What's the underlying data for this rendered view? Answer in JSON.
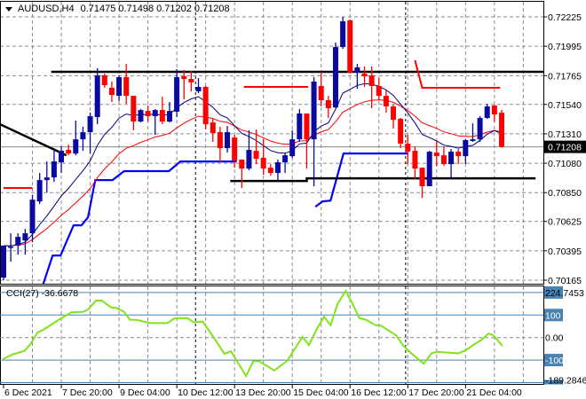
{
  "header": {
    "symbol": "AUDUSD,H4",
    "open": "0.71475",
    "high": "0.71498",
    "low": "0.71202",
    "close": "0.71208"
  },
  "indicator": {
    "name": "CCI(27)",
    "value": "-36.6678"
  },
  "colors": {
    "bull": "#0a0aa0",
    "bear": "#ff0000",
    "fast_ma": "#000080",
    "slow_ma": "#ff0000",
    "stop_line": "#0000ff",
    "cci": "#7fe51a",
    "cci_levels": "#4682b4",
    "grid": "#8a8a9a",
    "current_price_bg": "#000000"
  },
  "chart_data": [
    {
      "type": "candlestick",
      "title": "AUDUSD,H4",
      "ylim": [
        0.70165,
        0.72225
      ],
      "price_labels": [
        "0.72225",
        "0.71995",
        "0.71765",
        "0.71540",
        "0.71310",
        "0.71080",
        "0.70850",
        "0.70625",
        "0.70395",
        "0.70165"
      ],
      "current_price": "0.71208",
      "time_labels": [
        {
          "index": 0,
          "label": "6 Dec 2021"
        },
        {
          "index": 8,
          "label": "7 Dec 20:00"
        },
        {
          "index": 16,
          "label": "9 Dec 04:00"
        },
        {
          "index": 24,
          "label": "10 Dec 12:00"
        },
        {
          "index": 32,
          "label": "13 Dec 20:00"
        },
        {
          "index": 40,
          "label": "15 Dec 04:00"
        },
        {
          "index": 48,
          "label": "16 Dec 12:00"
        },
        {
          "index": 56,
          "label": "17 Dec 20:00"
        },
        {
          "index": 64,
          "label": "21 Dec 04:00"
        }
      ],
      "ohlc": [
        [
          0.70185,
          0.70435,
          0.70165,
          0.70435
        ],
        [
          0.70428,
          0.70532,
          0.7031,
          0.70428
        ],
        [
          0.70435,
          0.70532,
          0.70365,
          0.70504
        ],
        [
          0.70476,
          0.70566,
          0.70365,
          0.70532
        ],
        [
          0.70532,
          0.7083,
          0.70462,
          0.70795
        ],
        [
          0.70781,
          0.71004,
          0.70761,
          0.70948
        ],
        [
          0.70948,
          0.71094,
          0.70851,
          0.70969
        ],
        [
          0.70969,
          0.71198,
          0.70934,
          0.71094
        ],
        [
          0.71087,
          0.71212,
          0.71004,
          0.71177
        ],
        [
          0.71184,
          0.71226,
          0.71142,
          0.71156
        ],
        [
          0.71156,
          0.71413,
          0.71142,
          0.71267
        ],
        [
          0.71267,
          0.71365,
          0.71177,
          0.71323
        ],
        [
          0.71323,
          0.71476,
          0.71156,
          0.71448
        ],
        [
          0.71441,
          0.71823,
          0.71385,
          0.71767
        ],
        [
          0.71767,
          0.71781,
          0.7167,
          0.71691
        ],
        [
          0.7167,
          0.71719,
          0.71559,
          0.71614
        ],
        [
          0.71607,
          0.71767,
          0.71566,
          0.71753
        ],
        [
          0.71753,
          0.71857,
          0.71545,
          0.71607
        ],
        [
          0.71607,
          0.71607,
          0.71337,
          0.71406
        ],
        [
          0.71406,
          0.71503,
          0.71399,
          0.71496
        ],
        [
          0.71489,
          0.71531,
          0.71406,
          0.71448
        ],
        [
          0.71448,
          0.71503,
          0.71302,
          0.71496
        ],
        [
          0.71496,
          0.716,
          0.71385,
          0.71406
        ],
        [
          0.71406,
          0.71559,
          0.71399,
          0.71489
        ],
        [
          0.71483,
          0.71816,
          0.71441,
          0.71753
        ],
        [
          0.7176,
          0.71809,
          0.7158,
          0.71739
        ],
        [
          0.71739,
          0.71802,
          0.71642,
          0.71712
        ],
        [
          0.71642,
          0.71746,
          0.71628,
          0.71677
        ],
        [
          0.71677,
          0.71684,
          0.71344,
          0.71385
        ],
        [
          0.71399,
          0.71427,
          0.71247,
          0.71316
        ],
        [
          0.71323,
          0.71365,
          0.71087,
          0.71198
        ],
        [
          0.71198,
          0.71372,
          0.71163,
          0.71323
        ],
        [
          0.71281,
          0.71302,
          0.71045,
          0.71101
        ],
        [
          0.71108,
          0.71108,
          0.70886,
          0.71038
        ],
        [
          0.71038,
          0.71337,
          0.71024,
          0.71184
        ],
        [
          0.71177,
          0.71344,
          0.71073,
          0.71115
        ],
        [
          0.71122,
          0.71267,
          0.7099,
          0.71038
        ],
        [
          0.71045,
          0.71073,
          0.70983,
          0.71004
        ],
        [
          0.71004,
          0.71108,
          0.70948,
          0.71087
        ],
        [
          0.71087,
          0.71163,
          0.71004,
          0.71142
        ],
        [
          0.71135,
          0.71337,
          0.71122,
          0.71267
        ],
        [
          0.71267,
          0.71503,
          0.71247,
          0.71469
        ],
        [
          0.71469,
          0.71469,
          0.71038,
          0.71267
        ],
        [
          0.71267,
          0.71753,
          0.709,
          0.71719
        ],
        [
          0.71684,
          0.71795,
          0.71524,
          0.71573
        ],
        [
          0.71573,
          0.71607,
          0.71434,
          0.7151
        ],
        [
          0.71517,
          0.72024,
          0.7151,
          0.71989
        ],
        [
          0.71989,
          0.72225,
          0.71975,
          0.7219
        ],
        [
          0.72197,
          0.72204,
          0.71781,
          0.71788
        ],
        [
          0.71788,
          0.71857,
          0.71663,
          0.7183
        ],
        [
          0.71781,
          0.71837,
          0.71677,
          0.7176
        ],
        [
          0.71767,
          0.71837,
          0.7151,
          0.71684
        ],
        [
          0.71684,
          0.71746,
          0.71573,
          0.71607
        ],
        [
          0.71607,
          0.71649,
          0.71476,
          0.71524
        ],
        [
          0.71524,
          0.71538,
          0.71351,
          0.7142
        ],
        [
          0.71427,
          0.71434,
          0.71198,
          0.71233
        ],
        [
          0.71233,
          0.71302,
          0.71073,
          0.7117
        ],
        [
          0.71177,
          0.71212,
          0.70955,
          0.71038
        ],
        [
          0.71045,
          0.71045,
          0.70809,
          0.709
        ],
        [
          0.709,
          0.71177,
          0.709,
          0.7117
        ],
        [
          0.71163,
          0.71261,
          0.71059,
          0.71135
        ],
        [
          0.71142,
          0.71212,
          0.71059,
          0.71073
        ],
        [
          0.71073,
          0.71191,
          0.70955,
          0.7117
        ],
        [
          0.7117,
          0.71191,
          0.71073,
          0.71135
        ],
        [
          0.71135,
          0.71267,
          0.71073,
          0.71261
        ],
        [
          0.71254,
          0.71392,
          0.71247,
          0.71267
        ],
        [
          0.71267,
          0.71448,
          0.71247,
          0.71434
        ],
        [
          0.71434,
          0.71545,
          0.71427,
          0.71524
        ],
        [
          0.71531,
          0.71538,
          0.71406,
          0.71462
        ],
        [
          0.71475,
          0.71498,
          0.71202,
          0.71208
        ]
      ],
      "moving_averages": [
        {
          "name": "fast",
          "period": 10
        },
        {
          "name": "slow",
          "period": 20
        }
      ],
      "trend_lines": [
        {
          "name": "resistance-line",
          "color": "#000000",
          "points": [
            [
              6.6,
              0.71795
            ],
            [
              80,
              0.71795
            ]
          ]
        },
        {
          "name": "descending-line",
          "color": "#000000",
          "points": [
            [
              -0.5,
              0.71385
            ],
            [
              8.7,
              0.71142
            ]
          ]
        },
        {
          "name": "support-line",
          "color": "#000000",
          "points": [
            [
              31.4,
              0.70941
            ],
            [
              42,
              0.70941
            ],
            [
              42,
              0.70962
            ],
            [
              73.7,
              0.70962
            ]
          ]
        },
        {
          "name": "red-level-1",
          "color": "#ff0000",
          "points": [
            [
              0,
              0.70886
            ],
            [
              4,
              0.70886
            ]
          ]
        },
        {
          "name": "red-level-2",
          "color": "#ff0000",
          "points": [
            [
              33.3,
              0.71677
            ],
            [
              42.2,
              0.71677
            ]
          ]
        },
        {
          "name": "red-level-3",
          "color": "#ff0000",
          "points": [
            [
              57,
              0.71885
            ],
            [
              58,
              0.7167
            ],
            [
              68.8,
              0.7167
            ]
          ]
        }
      ],
      "stop_lines": [
        [
          [
            5.5,
            0.70136
          ],
          [
            6.8,
            0.70358
          ],
          [
            7.9,
            0.70358
          ],
          [
            9.7,
            0.70594
          ],
          [
            10.8,
            0.70594
          ],
          [
            11.7,
            0.70657
          ],
          [
            12.7,
            0.70948
          ],
          [
            15.1,
            0.70948
          ],
          [
            16.7,
            0.71018
          ],
          [
            22.9,
            0.71018
          ],
          [
            24.5,
            0.71094
          ],
          [
            32.3,
            0.71094
          ]
        ],
        [
          [
            43.2,
            0.7074
          ],
          [
            44.2,
            0.70781
          ],
          [
            45.3,
            0.70788
          ],
          [
            47.1,
            0.71156
          ],
          [
            56.0,
            0.71156
          ]
        ]
      ]
    },
    {
      "type": "line",
      "title": "CCI(27)",
      "ylim": [
        -189.2846,
        224.7453
      ],
      "levels": [
        200,
        100,
        0,
        -100,
        -200
      ],
      "axis_labels": {
        "max": "224.7453",
        "l100": "100",
        "zero": "0.00",
        "lm100": "-100",
        "min": "-189.2846"
      },
      "points": [
        [
          -0.1,
          -96
        ],
        [
          1.3,
          -74
        ],
        [
          2.9,
          -59
        ],
        [
          3.7,
          -30
        ],
        [
          4.7,
          22
        ],
        [
          5.7,
          38
        ],
        [
          7.8,
          82
        ],
        [
          9.4,
          112
        ],
        [
          11.0,
          114
        ],
        [
          11.7,
          124
        ],
        [
          12.8,
          164
        ],
        [
          13.6,
          164
        ],
        [
          14.9,
          134
        ],
        [
          15.6,
          132
        ],
        [
          16.7,
          114
        ],
        [
          17.5,
          79
        ],
        [
          18.5,
          78
        ],
        [
          20.3,
          64
        ],
        [
          22.7,
          64
        ],
        [
          23.7,
          86
        ],
        [
          25.5,
          86
        ],
        [
          26.3,
          68
        ],
        [
          27.6,
          71
        ],
        [
          29.2,
          -4
        ],
        [
          30.6,
          -72
        ],
        [
          31.5,
          -61
        ],
        [
          33.6,
          -171
        ],
        [
          34.6,
          -105
        ],
        [
          35.4,
          -105
        ],
        [
          37.5,
          -146
        ],
        [
          39.3,
          -103
        ],
        [
          41.4,
          3
        ],
        [
          42.3,
          -33
        ],
        [
          43.5,
          45
        ],
        [
          44.4,
          92
        ],
        [
          45.3,
          55
        ],
        [
          46.3,
          151
        ],
        [
          47.4,
          207
        ],
        [
          48.4,
          147
        ],
        [
          49.3,
          86
        ],
        [
          50.2,
          79
        ],
        [
          51.5,
          55
        ],
        [
          52.3,
          53
        ],
        [
          54.4,
          9
        ],
        [
          55.4,
          -37
        ],
        [
          56.5,
          -70
        ],
        [
          58.2,
          -116
        ],
        [
          59.3,
          -70
        ],
        [
          60.1,
          -63
        ],
        [
          63.0,
          -70
        ],
        [
          64.0,
          -57
        ],
        [
          65.3,
          -28
        ],
        [
          66.1,
          -13
        ],
        [
          67.2,
          18
        ],
        [
          67.9,
          9
        ],
        [
          69.1,
          -37
        ]
      ]
    }
  ]
}
